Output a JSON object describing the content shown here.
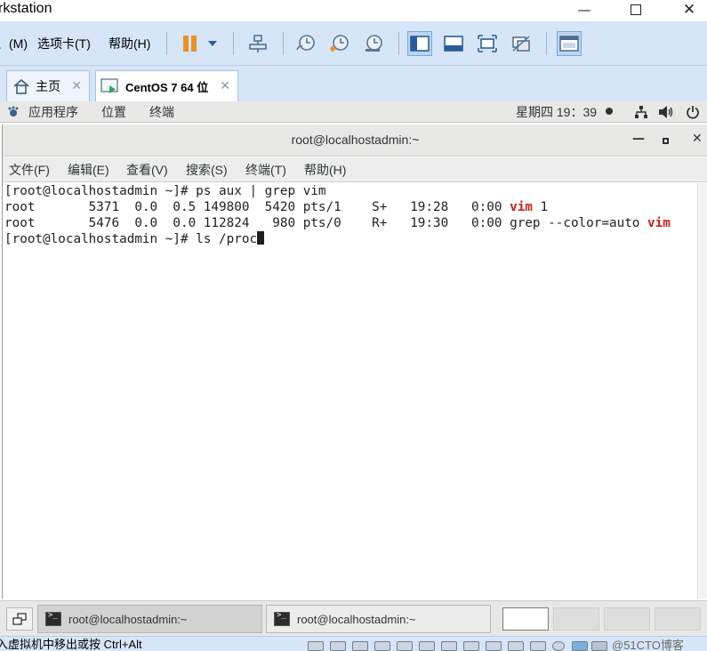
{
  "app": {
    "title": "rkstation"
  },
  "menubar": {
    "items": [
      "、(M)",
      "选项卡(T)",
      "帮助(H)"
    ]
  },
  "tabs": [
    {
      "label": "主页",
      "icon": "home-icon"
    },
    {
      "label": "CentOS 7 64 位",
      "icon": "vm-icon"
    }
  ],
  "gnome": {
    "applications": "应用程序",
    "places": "位置",
    "terminal": "终端",
    "clock": "星期四 19：39"
  },
  "terminal": {
    "title": "root@localhostadmin:~",
    "menu": [
      "文件(F)",
      "编辑(E)",
      "查看(V)",
      "搜索(S)",
      "终端(T)",
      "帮助(H)"
    ],
    "lines": {
      "l1": "[root@localhostadmin ~]# ps aux | grep vim",
      "l2_pre": "root       5371  0.0  0.5 149800  5420 pts/1    S+   19:28   0:00 ",
      "l2_vim": "vim",
      "l2_post": " 1",
      "l3_pre": "root       5476  0.0  0.0 112824   980 pts/0    R+   19:30   0:00 grep --color=auto ",
      "l3_vim": "vim",
      "l4": "[root@localhostadmin ~]# ls /proc"
    }
  },
  "taskbar": {
    "windows": [
      "root@localhostadmin:~",
      "root@localhostadmin:~"
    ]
  },
  "statusbar": {
    "message": "入虚拟机中移出或按 Ctrl+Alt",
    "watermark": "@51CTO博客"
  }
}
